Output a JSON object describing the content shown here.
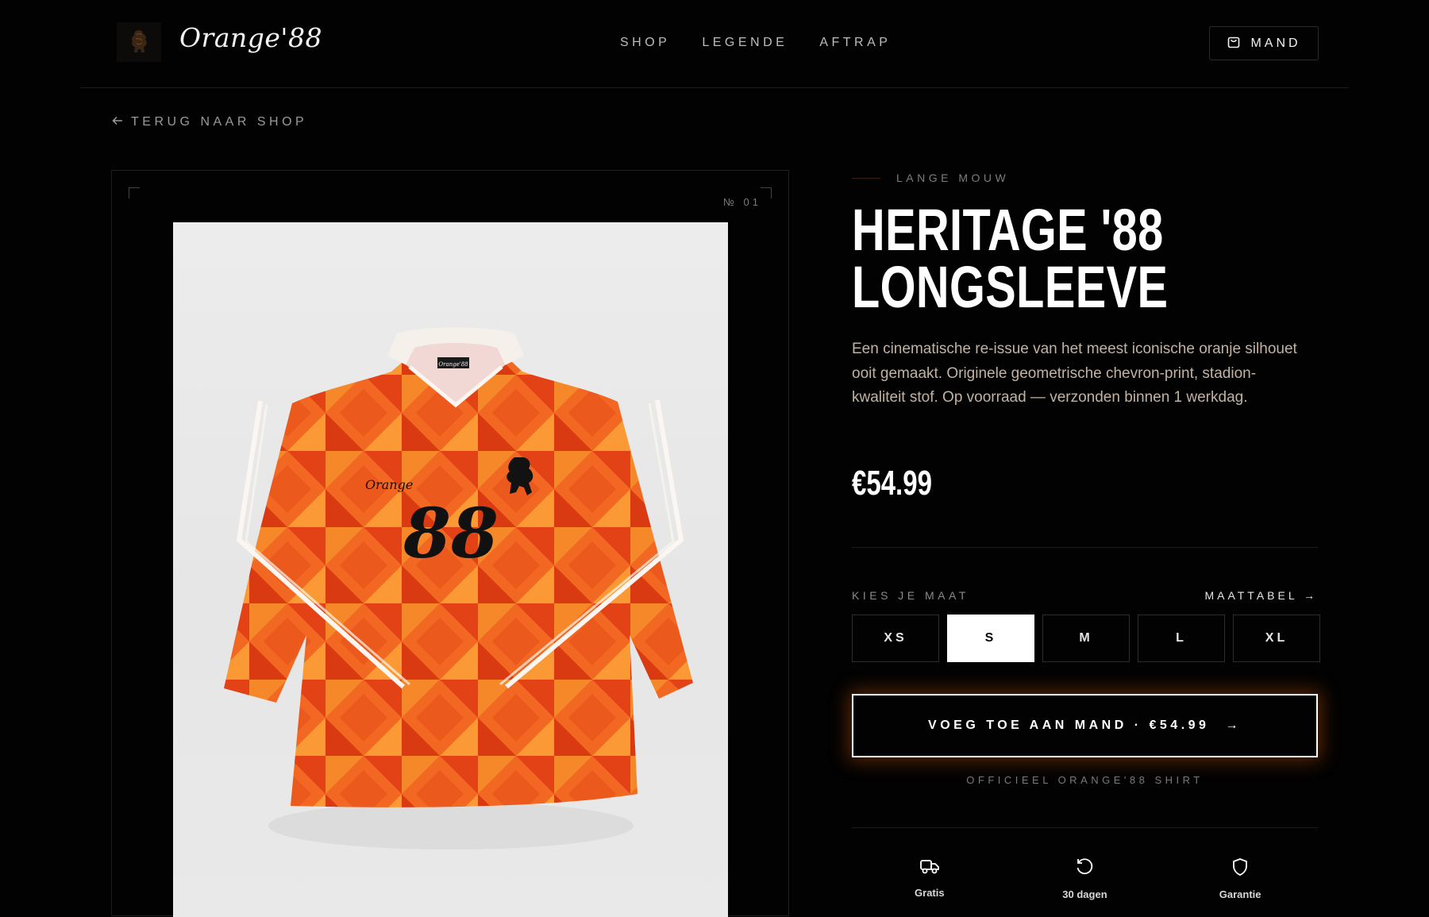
{
  "brand": {
    "name": "Orange'88"
  },
  "nav": {
    "items": [
      {
        "label": "SHOP"
      },
      {
        "label": "LEGENDE"
      },
      {
        "label": "AFTRAP"
      }
    ],
    "cart_label": "MAND"
  },
  "back_link": {
    "label": "TERUG NAAR SHOP"
  },
  "gallery": {
    "number_label": "№ 01",
    "jersey_brand_text": "Orange",
    "jersey_number": "88",
    "collar_label": "Orange'88"
  },
  "product": {
    "category": "LANGE MOUW",
    "title": "HERITAGE '88\nLONGSLEEVE",
    "description": "Een cinematische re-issue van het meest iconische oranje silhouet ooit gemaakt. Originele geometrische chevron-print, stadion-kwaliteit stof. Op voorraad — verzonden binnen 1 werkdag.",
    "price": "€54.99"
  },
  "size_selector": {
    "label": "KIES JE MAAT",
    "chart_link": "MAATTABEL →",
    "sizes": [
      {
        "label": "XS",
        "selected": false
      },
      {
        "label": "S",
        "selected": true
      },
      {
        "label": "M",
        "selected": false
      },
      {
        "label": "L",
        "selected": false
      },
      {
        "label": "XL",
        "selected": false
      }
    ]
  },
  "add_to_cart": {
    "label": "VOEG TOE AAN MAND · €54.99",
    "arrow": "→"
  },
  "official_note": "OFFICIEEL ORANGE'88 SHIRT",
  "features": [
    {
      "icon": "truck-icon",
      "label": "Gratis"
    },
    {
      "icon": "return-icon",
      "label": "30 dagen"
    },
    {
      "icon": "shield-icon",
      "label": "Garantie"
    }
  ],
  "colors": {
    "background": "#020202",
    "accent_glow": "#ff6e14",
    "jersey_orange": "#f05a1e",
    "description_text": "#c2b2a2"
  }
}
